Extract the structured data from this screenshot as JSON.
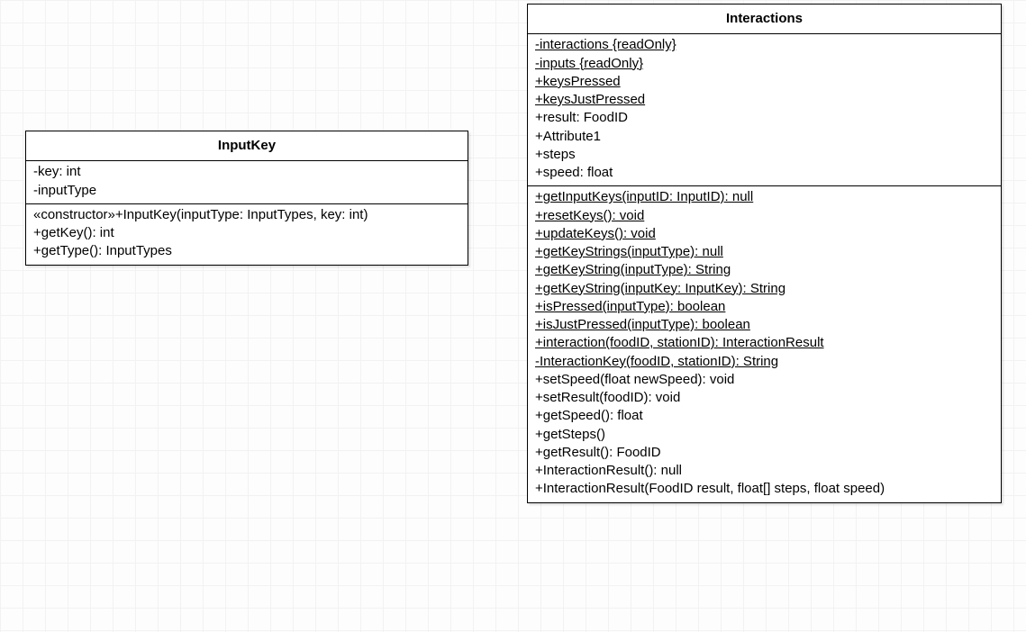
{
  "classes": {
    "inputKey": {
      "name": "InputKey",
      "attributes": [
        {
          "text": "-key: int",
          "static": false
        },
        {
          "text": "-inputType",
          "static": false
        }
      ],
      "methods": [
        {
          "text": "«constructor»+InputKey(inputType: InputTypes, key: int)",
          "static": false
        },
        {
          "text": "+getKey(): int",
          "static": false
        },
        {
          "text": "+getType(): InputTypes",
          "static": false
        }
      ]
    },
    "interactions": {
      "name": "Interactions",
      "attributes": [
        {
          "text": "-interactions {readOnly}",
          "static": true
        },
        {
          "text": "-inputs {readOnly}",
          "static": true
        },
        {
          "text": "+keysPressed",
          "static": true
        },
        {
          "text": "+keysJustPressed",
          "static": true
        },
        {
          "text": "+result: FoodID",
          "static": false
        },
        {
          "text": "+Attribute1",
          "static": false
        },
        {
          "text": "+steps",
          "static": false
        },
        {
          "text": "+speed: float",
          "static": false
        }
      ],
      "methods": [
        {
          "text": "+getInputKeys(inputID: InputID): null",
          "static": true
        },
        {
          "text": "+resetKeys(): void",
          "static": true
        },
        {
          "text": "+updateKeys(): void",
          "static": true
        },
        {
          "text": "+getKeyStrings(inputType): null",
          "static": true
        },
        {
          "text": "+getKeyString(inputType): String",
          "static": true
        },
        {
          "text": "+getKeyString(inputKey: InputKey): String",
          "static": true
        },
        {
          "text": "+isPressed(inputType): boolean",
          "static": true
        },
        {
          "text": "+isJustPressed(inputType): boolean",
          "static": true
        },
        {
          "text": "+interaction(foodID, stationID): InteractionResult",
          "static": true
        },
        {
          "text": "-InteractionKey(foodID, stationID): String",
          "static": true
        },
        {
          "text": "+setSpeed(float newSpeed): void",
          "static": false
        },
        {
          "text": "+setResult(foodID): void",
          "static": false
        },
        {
          "text": "+getSpeed(): float",
          "static": false
        },
        {
          "text": "+getSteps()",
          "static": false
        },
        {
          "text": "+getResult(): FoodID",
          "static": false
        },
        {
          "text": "+InteractionResult(): null",
          "static": false
        },
        {
          "text": "+InteractionResult(FoodID result, float[] steps, float speed)",
          "static": false
        }
      ]
    }
  }
}
